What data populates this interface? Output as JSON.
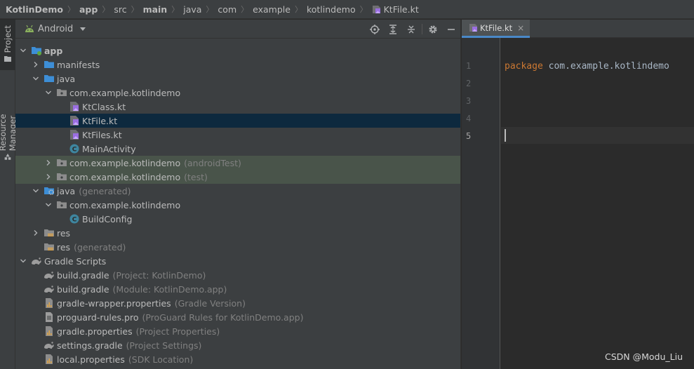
{
  "breadcrumb": {
    "items": [
      {
        "label": "KotlinDemo",
        "bold": true
      },
      {
        "label": "app",
        "bold": true
      },
      {
        "label": "src",
        "bold": false
      },
      {
        "label": "main",
        "bold": true
      },
      {
        "label": "java",
        "bold": false
      },
      {
        "label": "com",
        "bold": false
      },
      {
        "label": "example",
        "bold": false
      },
      {
        "label": "kotlindemo",
        "bold": false
      },
      {
        "label": "KtFile.kt",
        "bold": false
      }
    ]
  },
  "stripe": {
    "project_label": "Project",
    "resource_label": "Resource Manager"
  },
  "panel": {
    "view_label": "Android",
    "tools": [
      "locate-icon",
      "expand-all-icon",
      "collapse-all-icon",
      "gear-icon",
      "hide-icon"
    ]
  },
  "tree": {
    "rows": [
      {
        "label": "app",
        "hint": "",
        "indent": 0,
        "chev": "down",
        "icon": "module",
        "bold": true
      },
      {
        "label": "manifests",
        "hint": "",
        "indent": 1,
        "chev": "right",
        "icon": "folder"
      },
      {
        "label": "java",
        "hint": "",
        "indent": 1,
        "chev": "down",
        "icon": "folder"
      },
      {
        "label": "com.example.kotlindemo",
        "hint": "",
        "indent": 2,
        "chev": "down",
        "icon": "package"
      },
      {
        "label": "KtClass.kt",
        "hint": "",
        "indent": 3,
        "chev": "",
        "icon": "kotlin"
      },
      {
        "label": "KtFile.kt",
        "hint": "",
        "indent": 3,
        "chev": "",
        "icon": "kotlin",
        "state": "selected"
      },
      {
        "label": "KtFiles.kt",
        "hint": "",
        "indent": 3,
        "chev": "",
        "icon": "kotlin"
      },
      {
        "label": "MainActivity",
        "hint": "",
        "indent": 3,
        "chev": "",
        "icon": "class"
      },
      {
        "label": "com.example.kotlindemo",
        "hint": "(androidTest)",
        "indent": 2,
        "chev": "right",
        "icon": "package",
        "state": "test"
      },
      {
        "label": "com.example.kotlindemo",
        "hint": "(test)",
        "indent": 2,
        "chev": "right",
        "icon": "package",
        "state": "test"
      },
      {
        "label": "java",
        "hint": "(generated)",
        "indent": 1,
        "chev": "down",
        "icon": "genfolder"
      },
      {
        "label": "com.example.kotlindemo",
        "hint": "",
        "indent": 2,
        "chev": "down",
        "icon": "package"
      },
      {
        "label": "BuildConfig",
        "hint": "",
        "indent": 3,
        "chev": "",
        "icon": "class"
      },
      {
        "label": "res",
        "hint": "",
        "indent": 1,
        "chev": "right",
        "icon": "resfolder"
      },
      {
        "label": "res",
        "hint": "(generated)",
        "indent": 1,
        "chev": "",
        "icon": "resfolder"
      },
      {
        "label": "Gradle Scripts",
        "hint": "",
        "indent": 0,
        "chev": "down",
        "icon": "gradle"
      },
      {
        "label": "build.gradle",
        "hint": "(Project: KotlinDemo)",
        "indent": 1,
        "chev": "",
        "icon": "gradle"
      },
      {
        "label": "build.gradle",
        "hint": "(Module: KotlinDemo.app)",
        "indent": 1,
        "chev": "",
        "icon": "gradle"
      },
      {
        "label": "gradle-wrapper.properties",
        "hint": "(Gradle Version)",
        "indent": 1,
        "chev": "",
        "icon": "props"
      },
      {
        "label": "proguard-rules.pro",
        "hint": "(ProGuard Rules for KotlinDemo.app)",
        "indent": 1,
        "chev": "",
        "icon": "text"
      },
      {
        "label": "gradle.properties",
        "hint": "(Project Properties)",
        "indent": 1,
        "chev": "",
        "icon": "props"
      },
      {
        "label": "settings.gradle",
        "hint": "(Project Settings)",
        "indent": 1,
        "chev": "",
        "icon": "gradle"
      },
      {
        "label": "local.properties",
        "hint": "(SDK Location)",
        "indent": 1,
        "chev": "",
        "icon": "props"
      }
    ]
  },
  "editor": {
    "tab_label": "KtFile.kt",
    "tab_close": "×",
    "line_numbers": [
      "1",
      "2",
      "3",
      "4",
      "5"
    ],
    "current_line": 5,
    "code_keyword": "package",
    "code_rest": " com.example.kotlindemo"
  },
  "watermark": "CSDN @Modu_Liu",
  "colors": {
    "keyword": "#cc7832",
    "selection": "#0d293e",
    "test_bg": "#49544a",
    "folder": "#3d8ed6",
    "kotlin": "#9a6ee0"
  }
}
